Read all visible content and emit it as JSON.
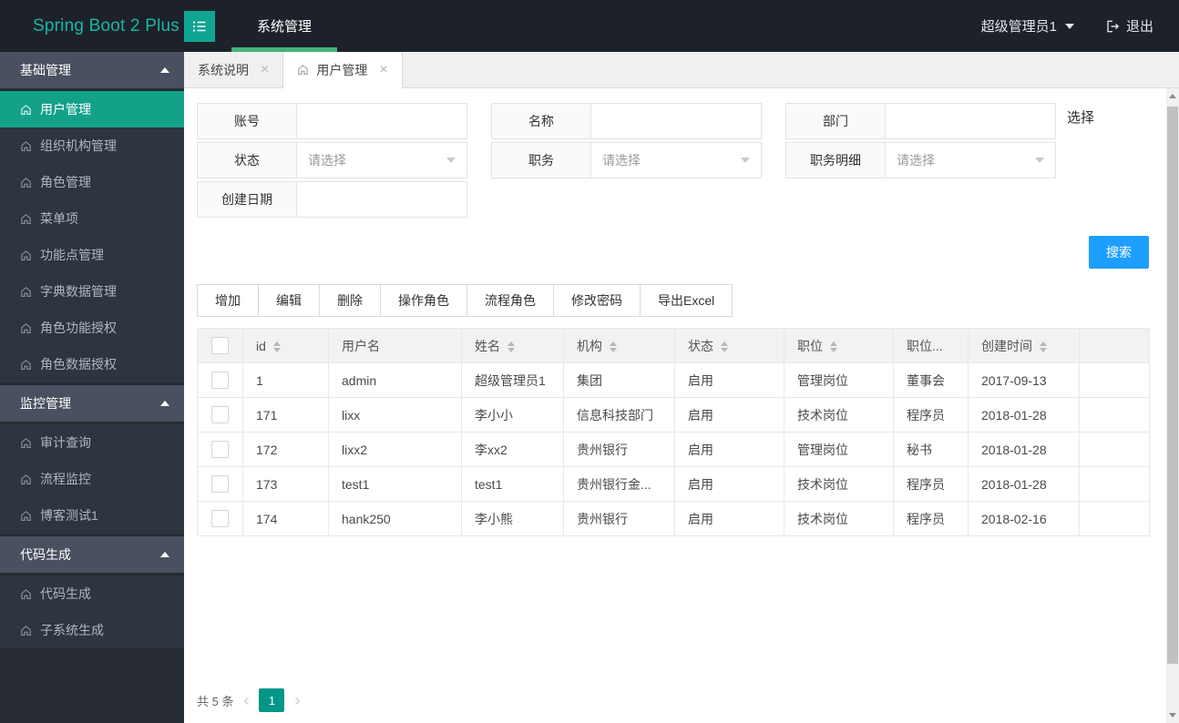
{
  "navbar": {
    "logo": "Spring Boot 2 Plus",
    "menu": [
      {
        "label": "系统管理",
        "active": true
      }
    ],
    "user": "超级管理员1",
    "logout_label": "退出"
  },
  "sidebar": {
    "sections": [
      {
        "title": "基础管理",
        "items": [
          {
            "label": "用户管理",
            "active": true
          },
          {
            "label": "组织机构管理"
          },
          {
            "label": "角色管理"
          },
          {
            "label": "菜单项"
          },
          {
            "label": "功能点管理"
          },
          {
            "label": "字典数据管理"
          },
          {
            "label": "角色功能授权"
          },
          {
            "label": "角色数据授权"
          }
        ]
      },
      {
        "title": "监控管理",
        "items": [
          {
            "label": "审计查询"
          },
          {
            "label": "流程监控"
          },
          {
            "label": "博客测试1"
          }
        ]
      },
      {
        "title": "代码生成",
        "items": [
          {
            "label": "代码生成"
          },
          {
            "label": "子系统生成"
          }
        ]
      }
    ]
  },
  "tabs": [
    {
      "label": "系统说明",
      "active": false,
      "closable": true,
      "has_home_icon": false
    },
    {
      "label": "用户管理",
      "active": true,
      "closable": true,
      "has_home_icon": true
    }
  ],
  "search_form": {
    "fields": [
      {
        "key": "account",
        "label": "账号",
        "type": "input",
        "value": ""
      },
      {
        "key": "name",
        "label": "名称",
        "type": "input",
        "value": ""
      },
      {
        "key": "department",
        "label": "部门",
        "type": "input",
        "value": "",
        "suffix": "选择"
      },
      {
        "key": "status",
        "label": "状态",
        "type": "select",
        "placeholder": "请选择"
      },
      {
        "key": "duty",
        "label": "职务",
        "type": "select",
        "placeholder": "请选择"
      },
      {
        "key": "duty-detail",
        "label": "职务明细",
        "type": "select",
        "placeholder": "请选择"
      },
      {
        "key": "create-date",
        "label": "创建日期",
        "type": "input",
        "value": ""
      }
    ],
    "search_button": "搜索"
  },
  "toolbar": {
    "buttons": [
      "增加",
      "编辑",
      "删除",
      "操作角色",
      "流程角色",
      "修改密码",
      "导出Excel"
    ]
  },
  "table": {
    "columns": [
      {
        "label": "",
        "type": "checkbox",
        "sortable": false
      },
      {
        "label": "id",
        "sortable": true
      },
      {
        "label": "用户名",
        "sortable": false
      },
      {
        "label": "姓名",
        "sortable": true
      },
      {
        "label": "机构",
        "sortable": true
      },
      {
        "label": "状态",
        "sortable": true
      },
      {
        "label": "职位",
        "sortable": true
      },
      {
        "label": "职位...",
        "sortable": false
      },
      {
        "label": "创建时间",
        "sortable": true
      },
      {
        "label": "",
        "type": "empty",
        "sortable": false
      }
    ],
    "rows": [
      [
        "1",
        "admin",
        "超级管理员1",
        "集团",
        "启用",
        "管理岗位",
        "董事会",
        "2017-09-13"
      ],
      [
        "171",
        "lixx",
        "李小小",
        "信息科技部门",
        "启用",
        "技术岗位",
        "程序员",
        "2018-01-28"
      ],
      [
        "172",
        "lixx2",
        "李xx2",
        "贵州银行",
        "启用",
        "管理岗位",
        "秘书",
        "2018-01-28"
      ],
      [
        "173",
        "test1",
        "test1",
        "贵州银行金...",
        "启用",
        "技术岗位",
        "程序员",
        "2018-01-28"
      ],
      [
        "174",
        "hank250",
        "李小熊",
        "贵州银行",
        "启用",
        "技术岗位",
        "程序员",
        "2018-02-16"
      ]
    ]
  },
  "pagination": {
    "total_label": "共 5 条",
    "current_page": "1"
  },
  "colors": {
    "navbar_bg": "#1d212a",
    "sidebar_bg": "#2e3440",
    "accent_teal": "#14a18a",
    "nav_underline_green": "#45b37c",
    "search_button_blue": "#1e9fff",
    "pagination_green": "#009688"
  }
}
